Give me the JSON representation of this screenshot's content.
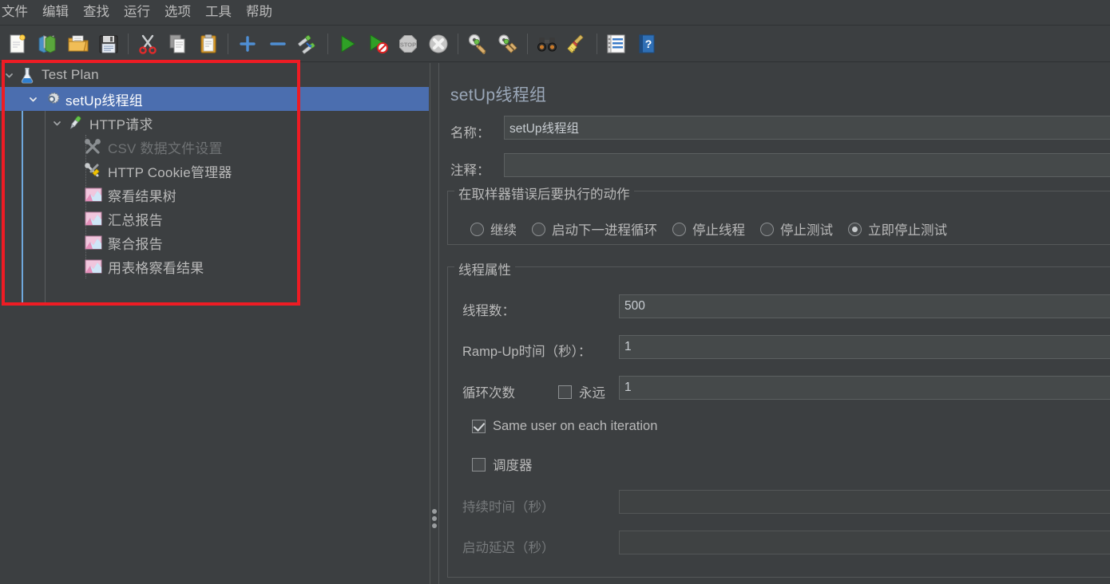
{
  "menubar": {
    "items": [
      {
        "label": "文件",
        "name": "menu-file"
      },
      {
        "label": "编辑",
        "name": "menu-edit"
      },
      {
        "label": "查找",
        "name": "menu-search"
      },
      {
        "label": "运行",
        "name": "menu-run"
      },
      {
        "label": "选项",
        "name": "menu-options"
      },
      {
        "label": "工具",
        "name": "menu-tools"
      },
      {
        "label": "帮助",
        "name": "menu-help"
      }
    ]
  },
  "toolbar": {
    "buttons": [
      {
        "icon": "new-file-icon"
      },
      {
        "icon": "templates-icon"
      },
      {
        "icon": "open-folder-icon"
      },
      {
        "icon": "save-icon"
      },
      {
        "icon": "separator"
      },
      {
        "icon": "cut-scissors-icon"
      },
      {
        "icon": "copy-icon"
      },
      {
        "icon": "paste-clipboard-icon"
      },
      {
        "icon": "separator"
      },
      {
        "icon": "expand-plus-icon"
      },
      {
        "icon": "collapse-minus-icon"
      },
      {
        "icon": "toggle-enable-icon"
      },
      {
        "icon": "separator"
      },
      {
        "icon": "start-play-icon"
      },
      {
        "icon": "start-no-timers-icon"
      },
      {
        "icon": "stop-icon"
      },
      {
        "icon": "shutdown-icon"
      },
      {
        "icon": "separator"
      },
      {
        "icon": "clear-icon"
      },
      {
        "icon": "clear-all-icon"
      },
      {
        "icon": "separator"
      },
      {
        "icon": "search-binoculars-icon"
      },
      {
        "icon": "reset-search-broom-icon"
      },
      {
        "icon": "separator"
      },
      {
        "icon": "function-helper-icon"
      },
      {
        "icon": "help-book-icon"
      }
    ]
  },
  "tree": {
    "nodes": [
      {
        "label": "Test Plan",
        "icon": "test-plan-icon",
        "depth": 0,
        "twisty": "down",
        "selected": false,
        "disabled": false,
        "name": "tree-node-test-plan"
      },
      {
        "label": "setUp线程组",
        "icon": "setup-thread-group-icon",
        "depth": 1,
        "twisty": "down",
        "selected": true,
        "disabled": false,
        "name": "tree-node-setup-thread-group"
      },
      {
        "label": "HTTP请求",
        "icon": "http-sampler-icon",
        "depth": 2,
        "twisty": "down",
        "selected": false,
        "disabled": false,
        "name": "tree-node-http-request"
      },
      {
        "label": "CSV 数据文件设置",
        "icon": "config-element-icon",
        "depth": 3,
        "twisty": "none",
        "selected": false,
        "disabled": true,
        "name": "tree-node-csv-data-set-config"
      },
      {
        "label": "HTTP Cookie管理器",
        "icon": "cookie-manager-icon",
        "depth": 3,
        "twisty": "none",
        "selected": false,
        "disabled": false,
        "name": "tree-node-http-cookie-manager"
      },
      {
        "label": "察看结果树",
        "icon": "listener-icon",
        "depth": 3,
        "twisty": "none",
        "selected": false,
        "disabled": false,
        "name": "tree-node-view-results-tree"
      },
      {
        "label": "汇总报告",
        "icon": "listener-icon",
        "depth": 3,
        "twisty": "none",
        "selected": false,
        "disabled": false,
        "name": "tree-node-summary-report"
      },
      {
        "label": "聚合报告",
        "icon": "listener-icon",
        "depth": 3,
        "twisty": "none",
        "selected": false,
        "disabled": false,
        "name": "tree-node-aggregate-report"
      },
      {
        "label": "用表格察看结果",
        "icon": "listener-icon",
        "depth": 3,
        "twisty": "none",
        "selected": false,
        "disabled": false,
        "name": "tree-node-view-results-in-table"
      }
    ]
  },
  "annotation": {
    "color": "#ee1c24",
    "shape": "rectangle-highlight"
  },
  "panel": {
    "title": "setUp线程组",
    "name_label": "名称：",
    "name_value": "setUp线程组",
    "comment_label": "注释：",
    "comment_value": "",
    "error_action": {
      "group_title": "在取样器错误后要执行的动作",
      "options": [
        {
          "label": "继续",
          "selected": false,
          "name": "radio-continue"
        },
        {
          "label": "启动下一进程循环",
          "selected": false,
          "name": "radio-start-next-loop"
        },
        {
          "label": "停止线程",
          "selected": false,
          "name": "radio-stop-thread"
        },
        {
          "label": "停止测试",
          "selected": false,
          "name": "radio-stop-test"
        },
        {
          "label": "立即停止测试",
          "selected": true,
          "name": "radio-stop-test-now"
        }
      ]
    },
    "thread_properties": {
      "group_title": "线程属性",
      "threads_label": "线程数：",
      "threads_value": "500",
      "rampup_label": "Ramp-Up时间（秒）：",
      "rampup_value": "1",
      "loops_label": "循环次数",
      "forever_label": "永远",
      "forever_checked": false,
      "loops_value": "1",
      "same_user_label": "Same user on each iteration",
      "same_user_checked": true,
      "scheduler_label": "调度器",
      "scheduler_checked": false,
      "duration_label": "持续时间（秒）",
      "duration_value": "",
      "duration_disabled": true,
      "startup_delay_label": "启动延迟（秒）",
      "startup_delay_value": "",
      "startup_delay_disabled": true
    }
  },
  "colors": {
    "background": "#3c3f41",
    "selection": "#4b6eaf",
    "text": "#b9b9b9",
    "title_text": "#9aa7b8",
    "disabled_text": "#6f7274",
    "annotation_red": "#ee1c24",
    "input_background": "#45494a"
  }
}
